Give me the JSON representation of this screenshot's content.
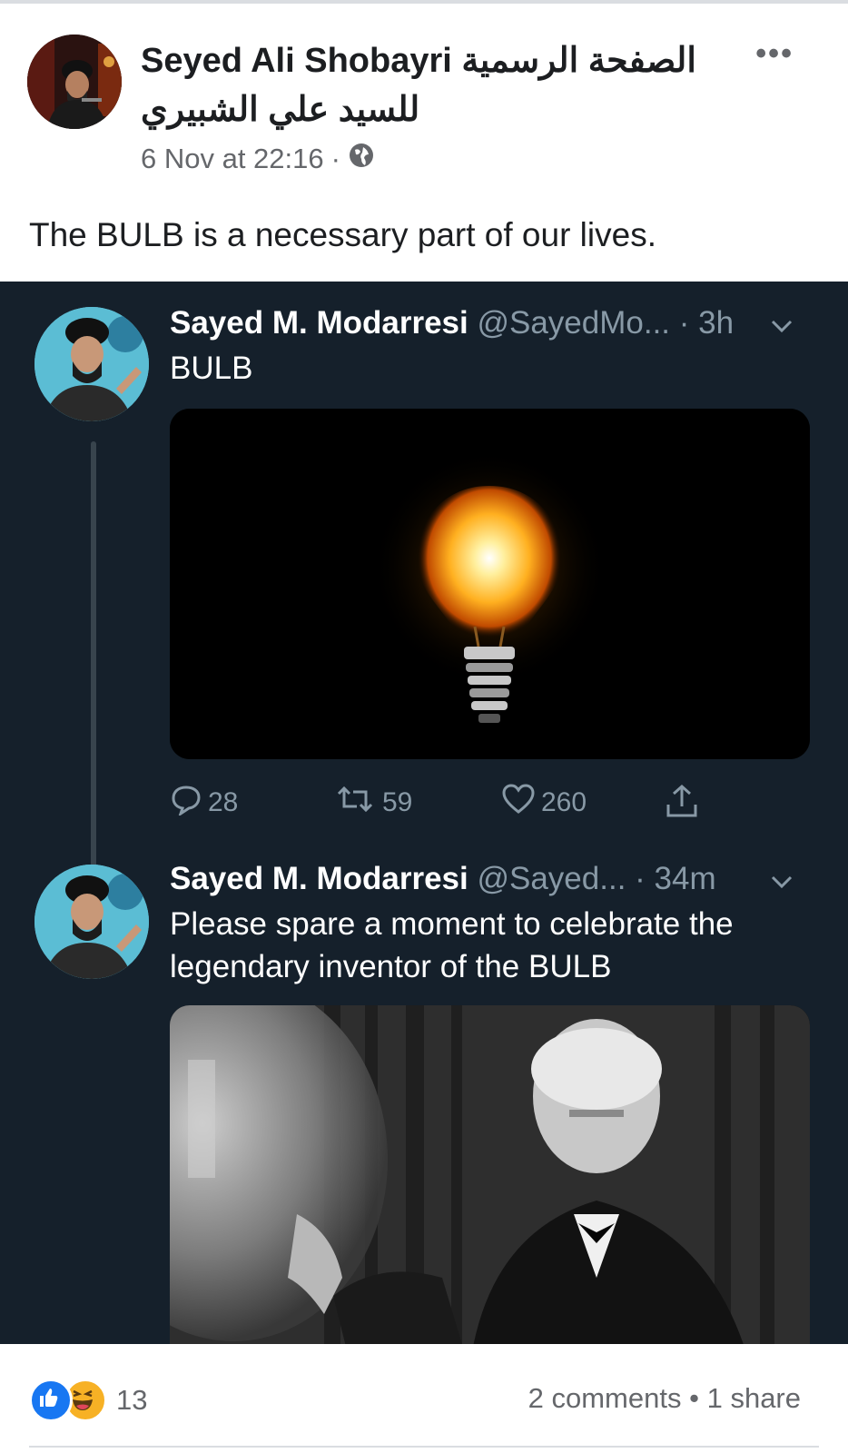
{
  "post": {
    "page_name": "Seyed Ali Shobayri",
    "page_name_ar_1": "الصفحة الرسمية",
    "page_name_ar_2": "للسيد علي الشبيري",
    "timestamp": "6 Nov at 22:16",
    "separator": "·",
    "audience_icon": "globe-icon",
    "more_label": "•••",
    "caption": "The BULB is a necessary part of our lives."
  },
  "tweets": [
    {
      "name": "Sayed M. Modarresi",
      "handle": "@SayedMo...",
      "time": "· 3h",
      "text": "BULB",
      "stats": {
        "replies": "28",
        "retweets": "59",
        "likes": "260"
      }
    },
    {
      "name": "Sayed M. Modarresi",
      "handle": "@Sayed...",
      "time": "· 34m",
      "text_line1": "Please spare a moment to celebrate the",
      "text_line2": "legendary inventor of the BULB"
    }
  ],
  "footer": {
    "reaction_count": "13",
    "comments": "2 comments",
    "dot": "•",
    "shares": "1 share"
  },
  "colors": {
    "twitter_bg": "#15202b",
    "facebook_blue": "#1877f2",
    "muted": "#65676b",
    "tweet_muted": "#8899a6"
  }
}
